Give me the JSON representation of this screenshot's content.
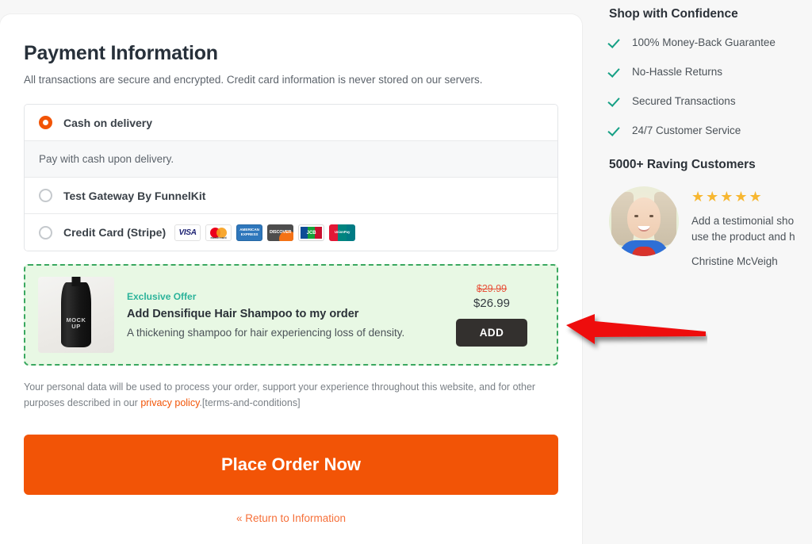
{
  "checkout": {
    "title": "Payment Information",
    "subtitle": "All transactions are secure and encrypted. Credit card information is never stored on our servers.",
    "payment_methods": [
      {
        "label": "Cash on delivery",
        "selected": true,
        "description": "Pay with cash upon delivery."
      },
      {
        "label": "Test Gateway By FunnelKit",
        "selected": false
      },
      {
        "label": "Credit Card (Stripe)",
        "selected": false,
        "card_icons": [
          "visa-icon",
          "mastercard-icon",
          "amex-icon",
          "discover-icon",
          "jcb-icon",
          "unionpay-icon"
        ]
      }
    ],
    "card_brands": {
      "visa": "VISA",
      "mastercard": "mastercard",
      "amex_line1": "AMERICAN",
      "amex_line2": "EXPRESS",
      "discover": "DISCOVER",
      "jcb": "JCB",
      "unionpay": "UnionPay"
    },
    "order_bump": {
      "tag": "Exclusive Offer",
      "title": "Add Densifique Hair Shampoo to my order",
      "description": "A thickening shampoo for hair experiencing loss of density.",
      "price_old": "$29.99",
      "price_new": "$26.99",
      "add_button": "ADD",
      "thumb_text": "MOCK UP",
      "accent_color": "#3aa860",
      "background_color": "#e8f8e4"
    },
    "privacy": {
      "text_before": "Your personal data will be used to process your order, support your experience throughout this website, and for other purposes described in our ",
      "link": "privacy policy",
      "text_after": ".[terms-and-conditions]"
    },
    "place_order_label": "Place Order Now",
    "return_link": "« Return to Information",
    "accent_color": "#f25406"
  },
  "sidebar": {
    "confidence_title": "Shop with Confidence",
    "confidence_items": [
      "100% Money-Back Guarantee",
      "No-Hassle Returns",
      "Secured Transactions",
      "24/7 Customer Service"
    ],
    "raving_title": "5000+ Raving Customers",
    "testimonial": {
      "stars": "★★★★★",
      "rating": 5,
      "text": "Add a testimonial sho\nuse the product and h",
      "text_line1": "Add a testimonial sho",
      "text_line2": "use the product and h",
      "author": "Christine McVeigh"
    },
    "check_color": "#16a085",
    "star_color": "#f7b731"
  },
  "annotation": {
    "type": "arrow",
    "direction": "left",
    "color": "#ee1111",
    "points_to": "add-button"
  }
}
